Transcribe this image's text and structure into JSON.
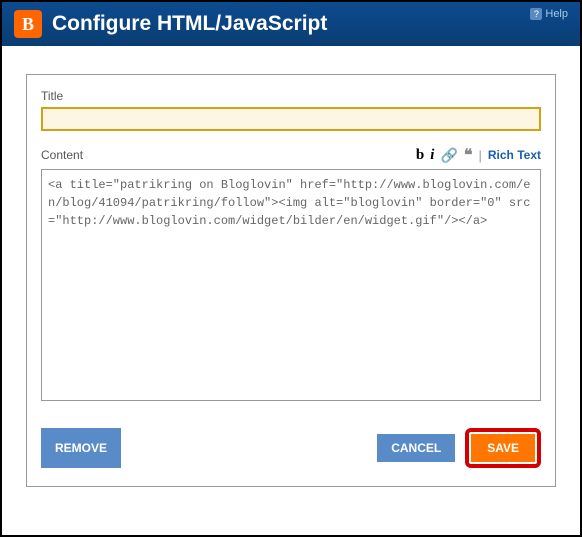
{
  "header": {
    "logo_letter": "B",
    "title": "Configure HTML/JavaScript",
    "help_label": "Help"
  },
  "form": {
    "title_label": "Title",
    "title_value": "",
    "content_label": "Content",
    "content_value": "<a title=\"patrikring on Bloglovin\" href=\"http://www.bloglovin.com/en/blog/41094/patrikring/follow\"><img alt=\"bloglovin\" border=\"0\" src=\"http://www.bloglovin.com/widget/bilder/en/widget.gif\"/></a>"
  },
  "toolbar": {
    "bold": "b",
    "italic": "i",
    "link_icon": "🔗",
    "quote": "❝",
    "separator": "|",
    "rich_text": "Rich Text"
  },
  "buttons": {
    "remove": "REMOVE",
    "cancel": "CANCEL",
    "save": "SAVE"
  }
}
